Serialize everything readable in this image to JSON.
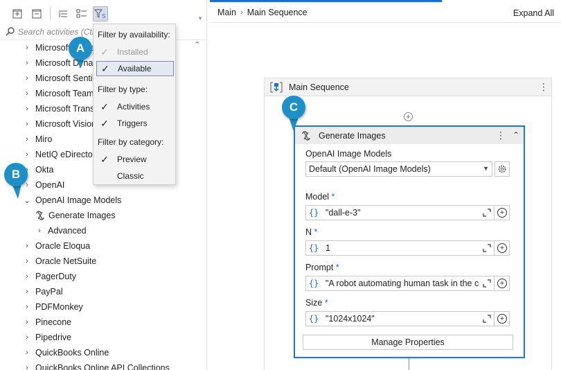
{
  "toolbar": {
    "filter_badge": "S"
  },
  "search": {
    "placeholder": "Search activities (Ctrl+Alt+F)"
  },
  "tree": {
    "items": [
      {
        "label": "Microsoft Azure"
      },
      {
        "label": "Microsoft Dynamics"
      },
      {
        "label": "Microsoft Sentinel"
      },
      {
        "label": "Microsoft Teams"
      },
      {
        "label": "Microsoft Translator"
      },
      {
        "label": "Microsoft Vision"
      },
      {
        "label": "Miro"
      },
      {
        "label": "NetIQ eDirectory"
      },
      {
        "label": "Okta"
      },
      {
        "label": "OpenAI"
      },
      {
        "label": "OpenAI Image Models"
      },
      {
        "label": "Generate Images"
      },
      {
        "label": "Advanced"
      },
      {
        "label": "Oracle Eloqua"
      },
      {
        "label": "Oracle NetSuite"
      },
      {
        "label": "PagerDuty"
      },
      {
        "label": "PayPal"
      },
      {
        "label": "PDFMonkey"
      },
      {
        "label": "Pinecone"
      },
      {
        "label": "Pipedrive"
      },
      {
        "label": "QuickBooks Online"
      },
      {
        "label": "QuickBooks Online API Collections"
      }
    ]
  },
  "filter": {
    "availability_header": "Filter by availability:",
    "installed": "Installed",
    "available": "Available",
    "type_header": "Filter by type:",
    "activities": "Activities",
    "triggers": "Triggers",
    "category_header": "Filter by category:",
    "preview": "Preview",
    "classic": "Classic"
  },
  "callouts": {
    "a": "A",
    "b": "B",
    "c": "C"
  },
  "breadcrumb": {
    "root": "Main",
    "current": "Main Sequence",
    "expand_all": "Expand All"
  },
  "sequence": {
    "title": "Main Sequence"
  },
  "activity": {
    "title": "Generate Images",
    "connection_label": "OpenAI Image Models",
    "connection_value": "Default (OpenAI Image Models)",
    "model_label": "Model",
    "model_value": "\"dall-e-3\"",
    "n_label": "N",
    "n_value": "1",
    "prompt_label": "Prompt",
    "prompt_value": "\"A robot automating human task in the co",
    "size_label": "Size",
    "size_value": "\"1024x1024\"",
    "required_mark": "*",
    "brace": "{}",
    "manage_button": "Manage Properties"
  },
  "colors": {
    "accent_blue": "#1f73d6",
    "callout_blue": "#1f8fc8"
  }
}
